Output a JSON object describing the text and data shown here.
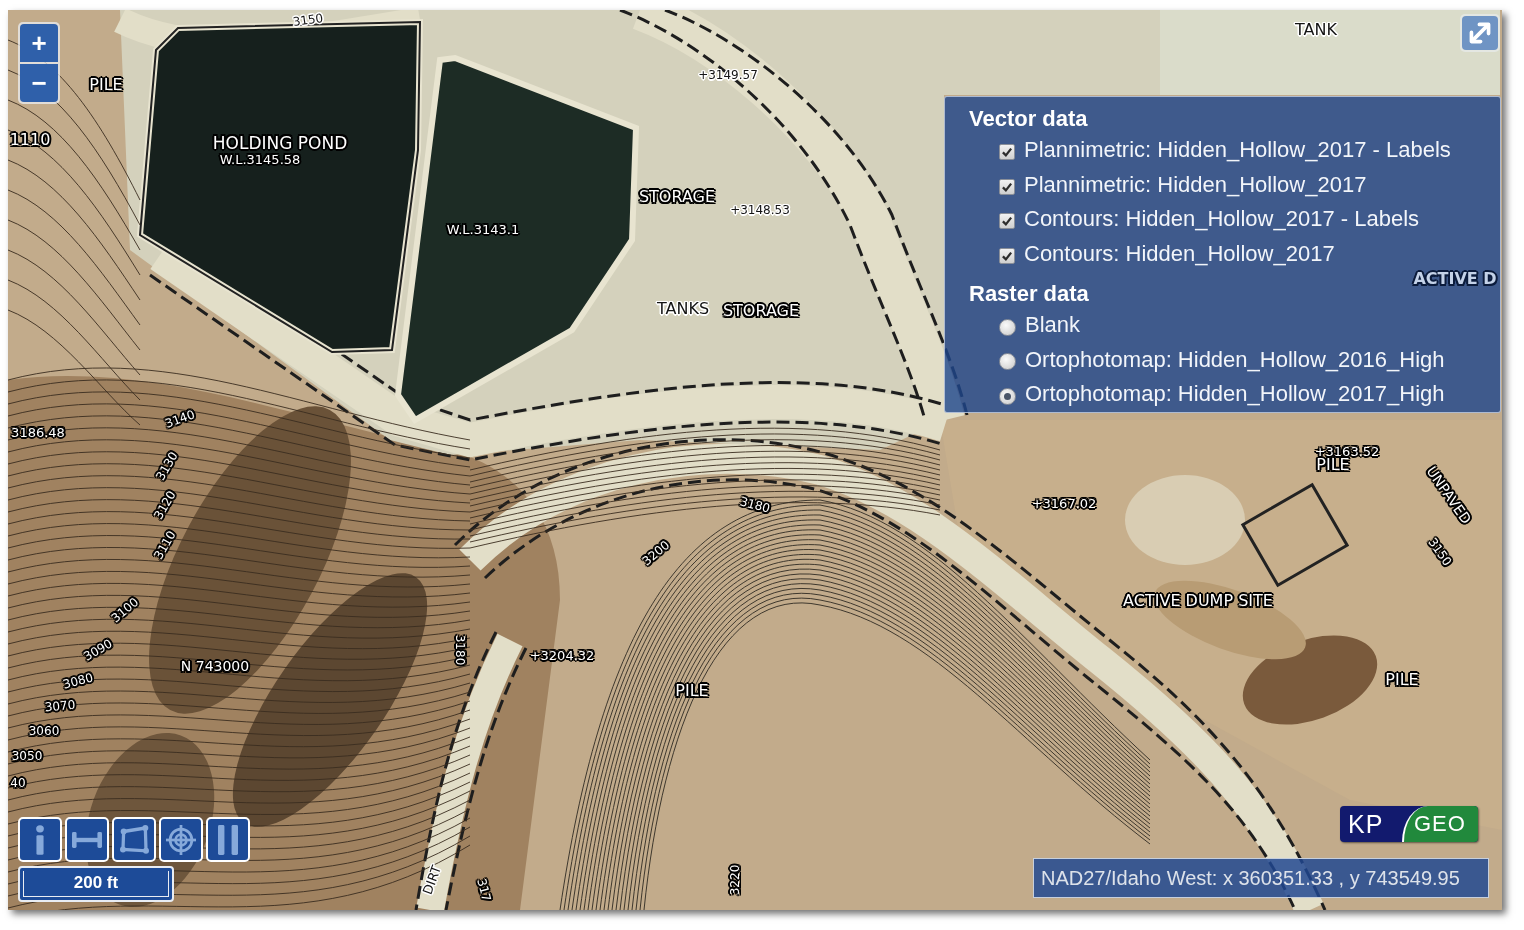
{
  "map": {
    "zoom_in": "+",
    "zoom_out": "−",
    "labels": [
      "3150",
      "PILE",
      "1110",
      "HOLDING POND",
      "W.L.3145.58",
      "W.L.3143.1",
      "+3149.57",
      "STORAGE",
      "+3148.53",
      "TANKS",
      "STORAGE",
      "TANK",
      "ACTIVE D",
      "3186.48",
      "3140",
      "3130",
      "3120",
      "3110",
      "3100",
      "3090",
      "3080",
      "3070",
      "3060",
      "3050",
      "40",
      "N 743000",
      "3180",
      "+3204.32",
      "3200",
      "3180",
      "PILE",
      "+3167.02",
      "+3163.52",
      "PILE",
      "UNPAVED",
      "3150",
      "ACTIVE DUMP SITE",
      "PILE",
      "DIRT",
      "317",
      "3220"
    ]
  },
  "layer_panel": {
    "groups": [
      {
        "title": "Vector data",
        "kind": "checkbox",
        "layers": [
          {
            "label": "Plannimetric: Hidden_Hollow_2017 - Labels",
            "checked": true
          },
          {
            "label": "Plannimetric: Hidden_Hollow_2017",
            "checked": true
          },
          {
            "label": "Contours: Hidden_Hollow_2017 - Labels",
            "checked": true
          },
          {
            "label": "Contours: Hidden_Hollow_2017",
            "checked": true
          }
        ]
      },
      {
        "title": "Raster data",
        "kind": "radio",
        "layers": [
          {
            "label": "Blank",
            "selected": false
          },
          {
            "label": "Ortophotomap: Hidden_Hollow_2016_High",
            "selected": false
          },
          {
            "label": "Ortophotomap: Hidden_Hollow_2017_High",
            "selected": true
          }
        ]
      }
    ]
  },
  "tools": [
    {
      "kind": "info"
    },
    {
      "kind": "distance"
    },
    {
      "kind": "area"
    },
    {
      "kind": "locate"
    },
    {
      "kind": "columns"
    }
  ],
  "scale": "200 ft",
  "logo": {
    "left": "KP",
    "right": "GEO"
  },
  "coordinates": "NAD27/Idaho West: x 360351.33 , y 743549.95"
}
